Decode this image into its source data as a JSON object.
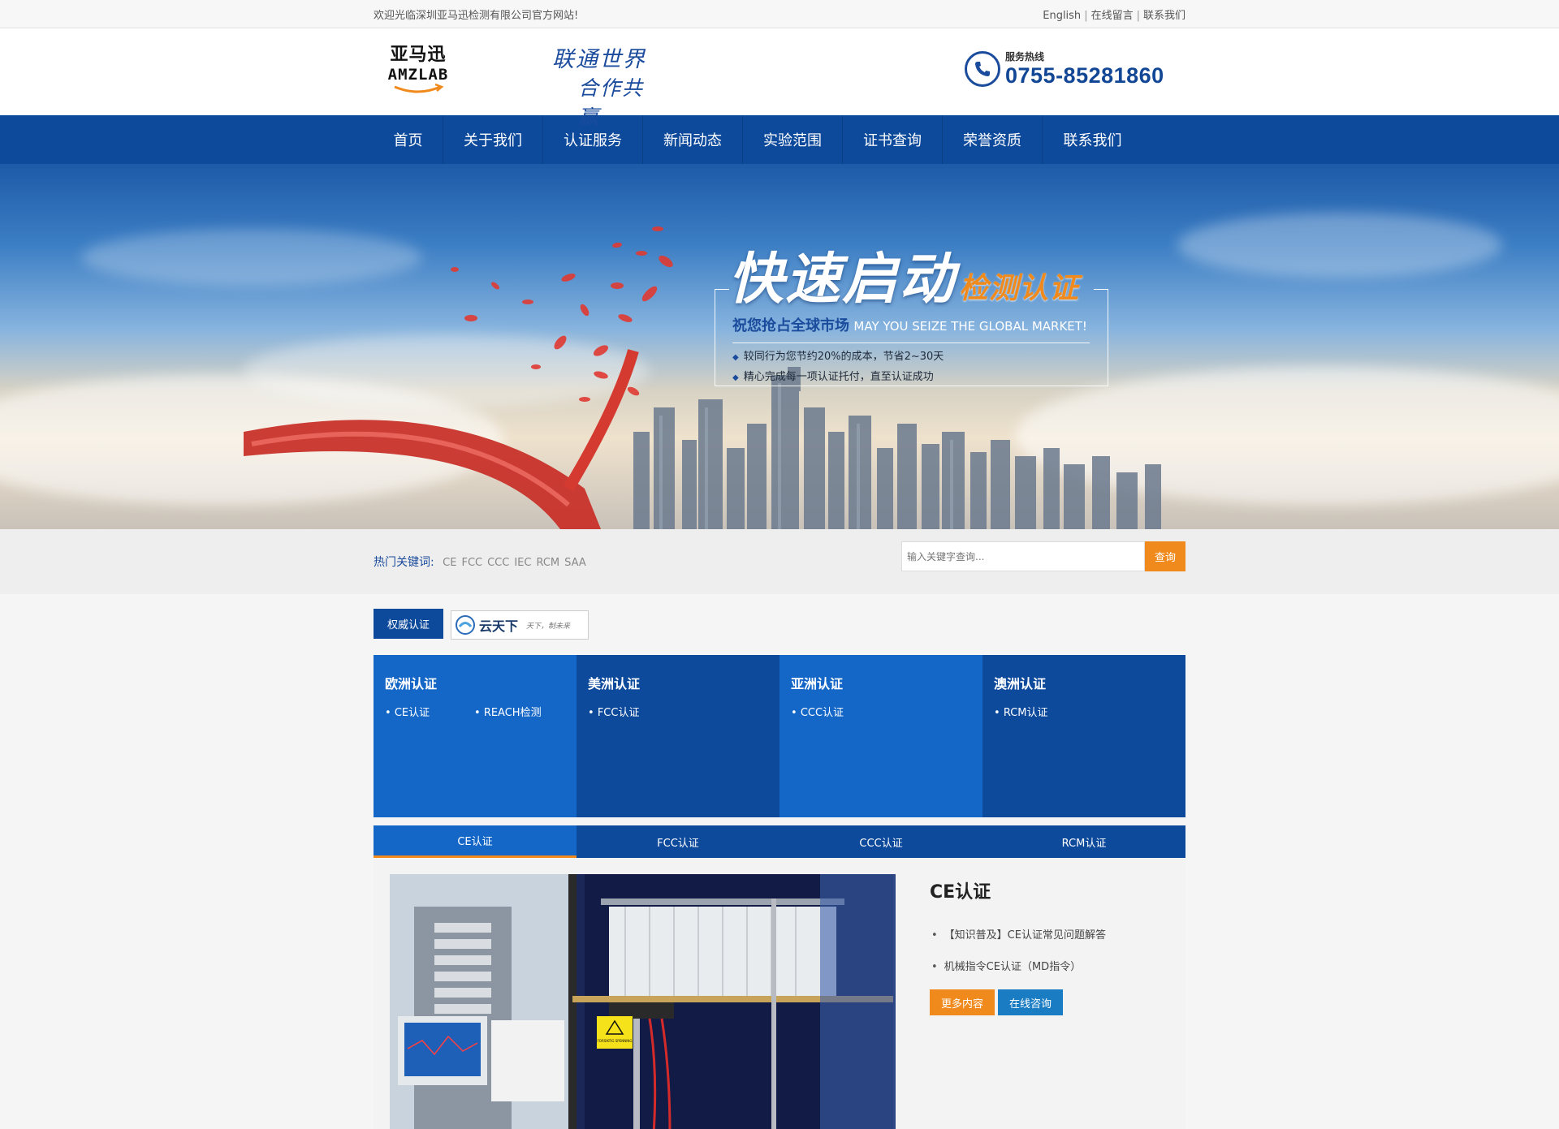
{
  "topbar": {
    "welcome": "欢迎光临深圳亚马迅检测有限公司官方网站!",
    "links": [
      "English",
      "在线留言",
      "联系我们"
    ]
  },
  "header": {
    "logo_cn": "亚马迅",
    "logo_en": "AMZLAB",
    "slogan_line1": "联通世界",
    "slogan_line2": "合作共赢",
    "hotline_label": "服务热线",
    "hotline_number": "0755-85281860"
  },
  "nav": [
    "首页",
    "关于我们",
    "认证服务",
    "新闻动态",
    "实验范围",
    "证书查询",
    "荣誉资质",
    "联系我们"
  ],
  "banner": {
    "title_big": "快速启动",
    "title_small": "检测认证",
    "sub_cn": "祝您抢占全球市场",
    "sub_en": "MAY YOU SEIZE THE GLOBAL MARKET!",
    "bullets": [
      "较同行为您节约20%的成本，节省2~30天",
      "精心完成每一项认证托付，直至认证成功"
    ]
  },
  "search": {
    "hot_label": "热门关键词:",
    "keywords": [
      "CE",
      "FCC",
      "CCC",
      "IEC",
      "RCM",
      "SAA"
    ],
    "placeholder": "输入关键字查询...",
    "button": "查询"
  },
  "section": {
    "tag": "权威认证",
    "partner_name": "云天下",
    "partner_tagline": "天下，制未来",
    "partner_url": "www.yuntianxia.com"
  },
  "regions": [
    {
      "title": "欧洲认证",
      "items": [
        "CE认证",
        "REACH检测"
      ]
    },
    {
      "title": "美洲认证",
      "items": [
        "FCC认证"
      ]
    },
    {
      "title": "亚洲认证",
      "items": [
        "CCC认证"
      ]
    },
    {
      "title": "澳洲认证",
      "items": [
        "RCM认证"
      ]
    }
  ],
  "tabs": [
    "CE认证",
    "FCC认证",
    "CCC认证",
    "RCM认证"
  ],
  "content": {
    "title": "CE认证",
    "list": [
      "【知识普及】CE认证常见问题解答",
      "机械指令CE认证（MD指令）"
    ],
    "btn_more": "更多内容",
    "btn_consult": "在线咨询",
    "sign_text": "FORSIKTIG SPENNING"
  },
  "colors": {
    "brand_blue": "#0d4a9c",
    "light_blue": "#1567c7",
    "orange": "#f08a1c"
  }
}
